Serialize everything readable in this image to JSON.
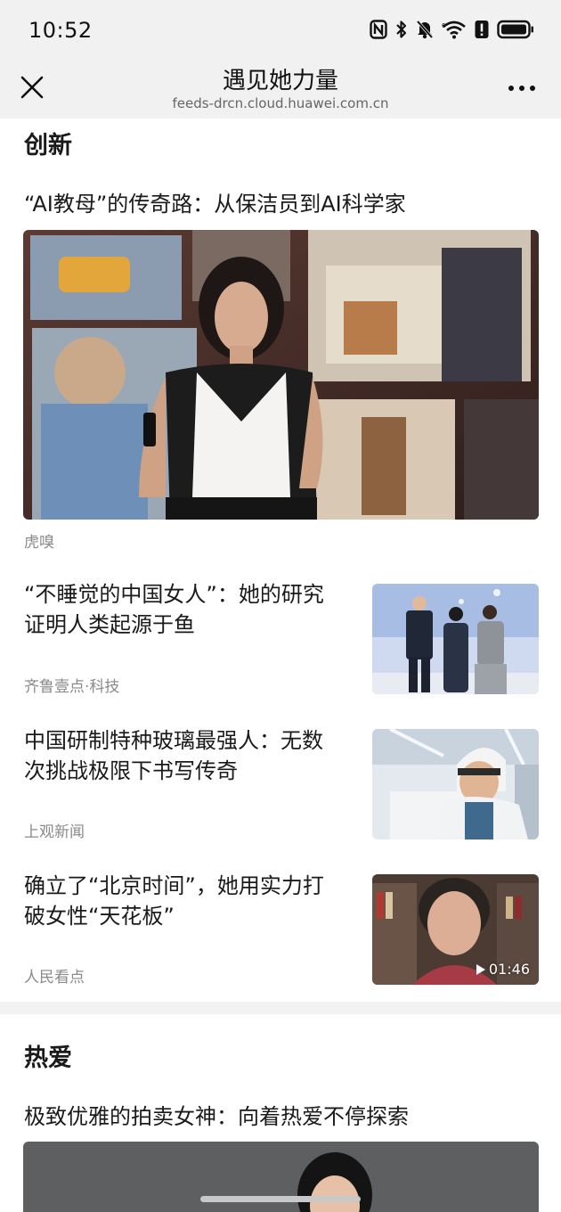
{
  "status_bar": {
    "time": "10:52",
    "icons": [
      "nfc-icon",
      "bluetooth-icon",
      "mute-bell-icon",
      "wifi-icon",
      "alert-icon",
      "battery-icon"
    ]
  },
  "nav": {
    "title": "遇见她力量",
    "url": "feeds-drcn.cloud.huawei.com.cn"
  },
  "sections": [
    {
      "title": "创新",
      "featured": {
        "headline": "“AI教母”的传奇路：从保洁员到AI科学家",
        "source": "虎嗅"
      },
      "items": [
        {
          "line1": "“不睡觉的中国女人”：她的研究",
          "line2": "证明人类起源于鱼",
          "source": "齐鲁壹点·科技"
        },
        {
          "line1": "中国研制特种玻璃最强人：无数",
          "line2": "次挑战极限下书写传奇",
          "source": "上观新闻"
        },
        {
          "line1": "确立了“北京时间”，她用实力打",
          "line2": "破女性“天花板”",
          "source": "人民看点",
          "duration": "01:46"
        }
      ]
    },
    {
      "title": "热爱",
      "featured": {
        "headline": "极致优雅的拍卖女神：向着热爱不停探索"
      }
    }
  ],
  "colors": {
    "bar_background": "#f1f1f1",
    "text_primary": "#1a1a1a",
    "text_secondary": "#8a8a8a"
  }
}
